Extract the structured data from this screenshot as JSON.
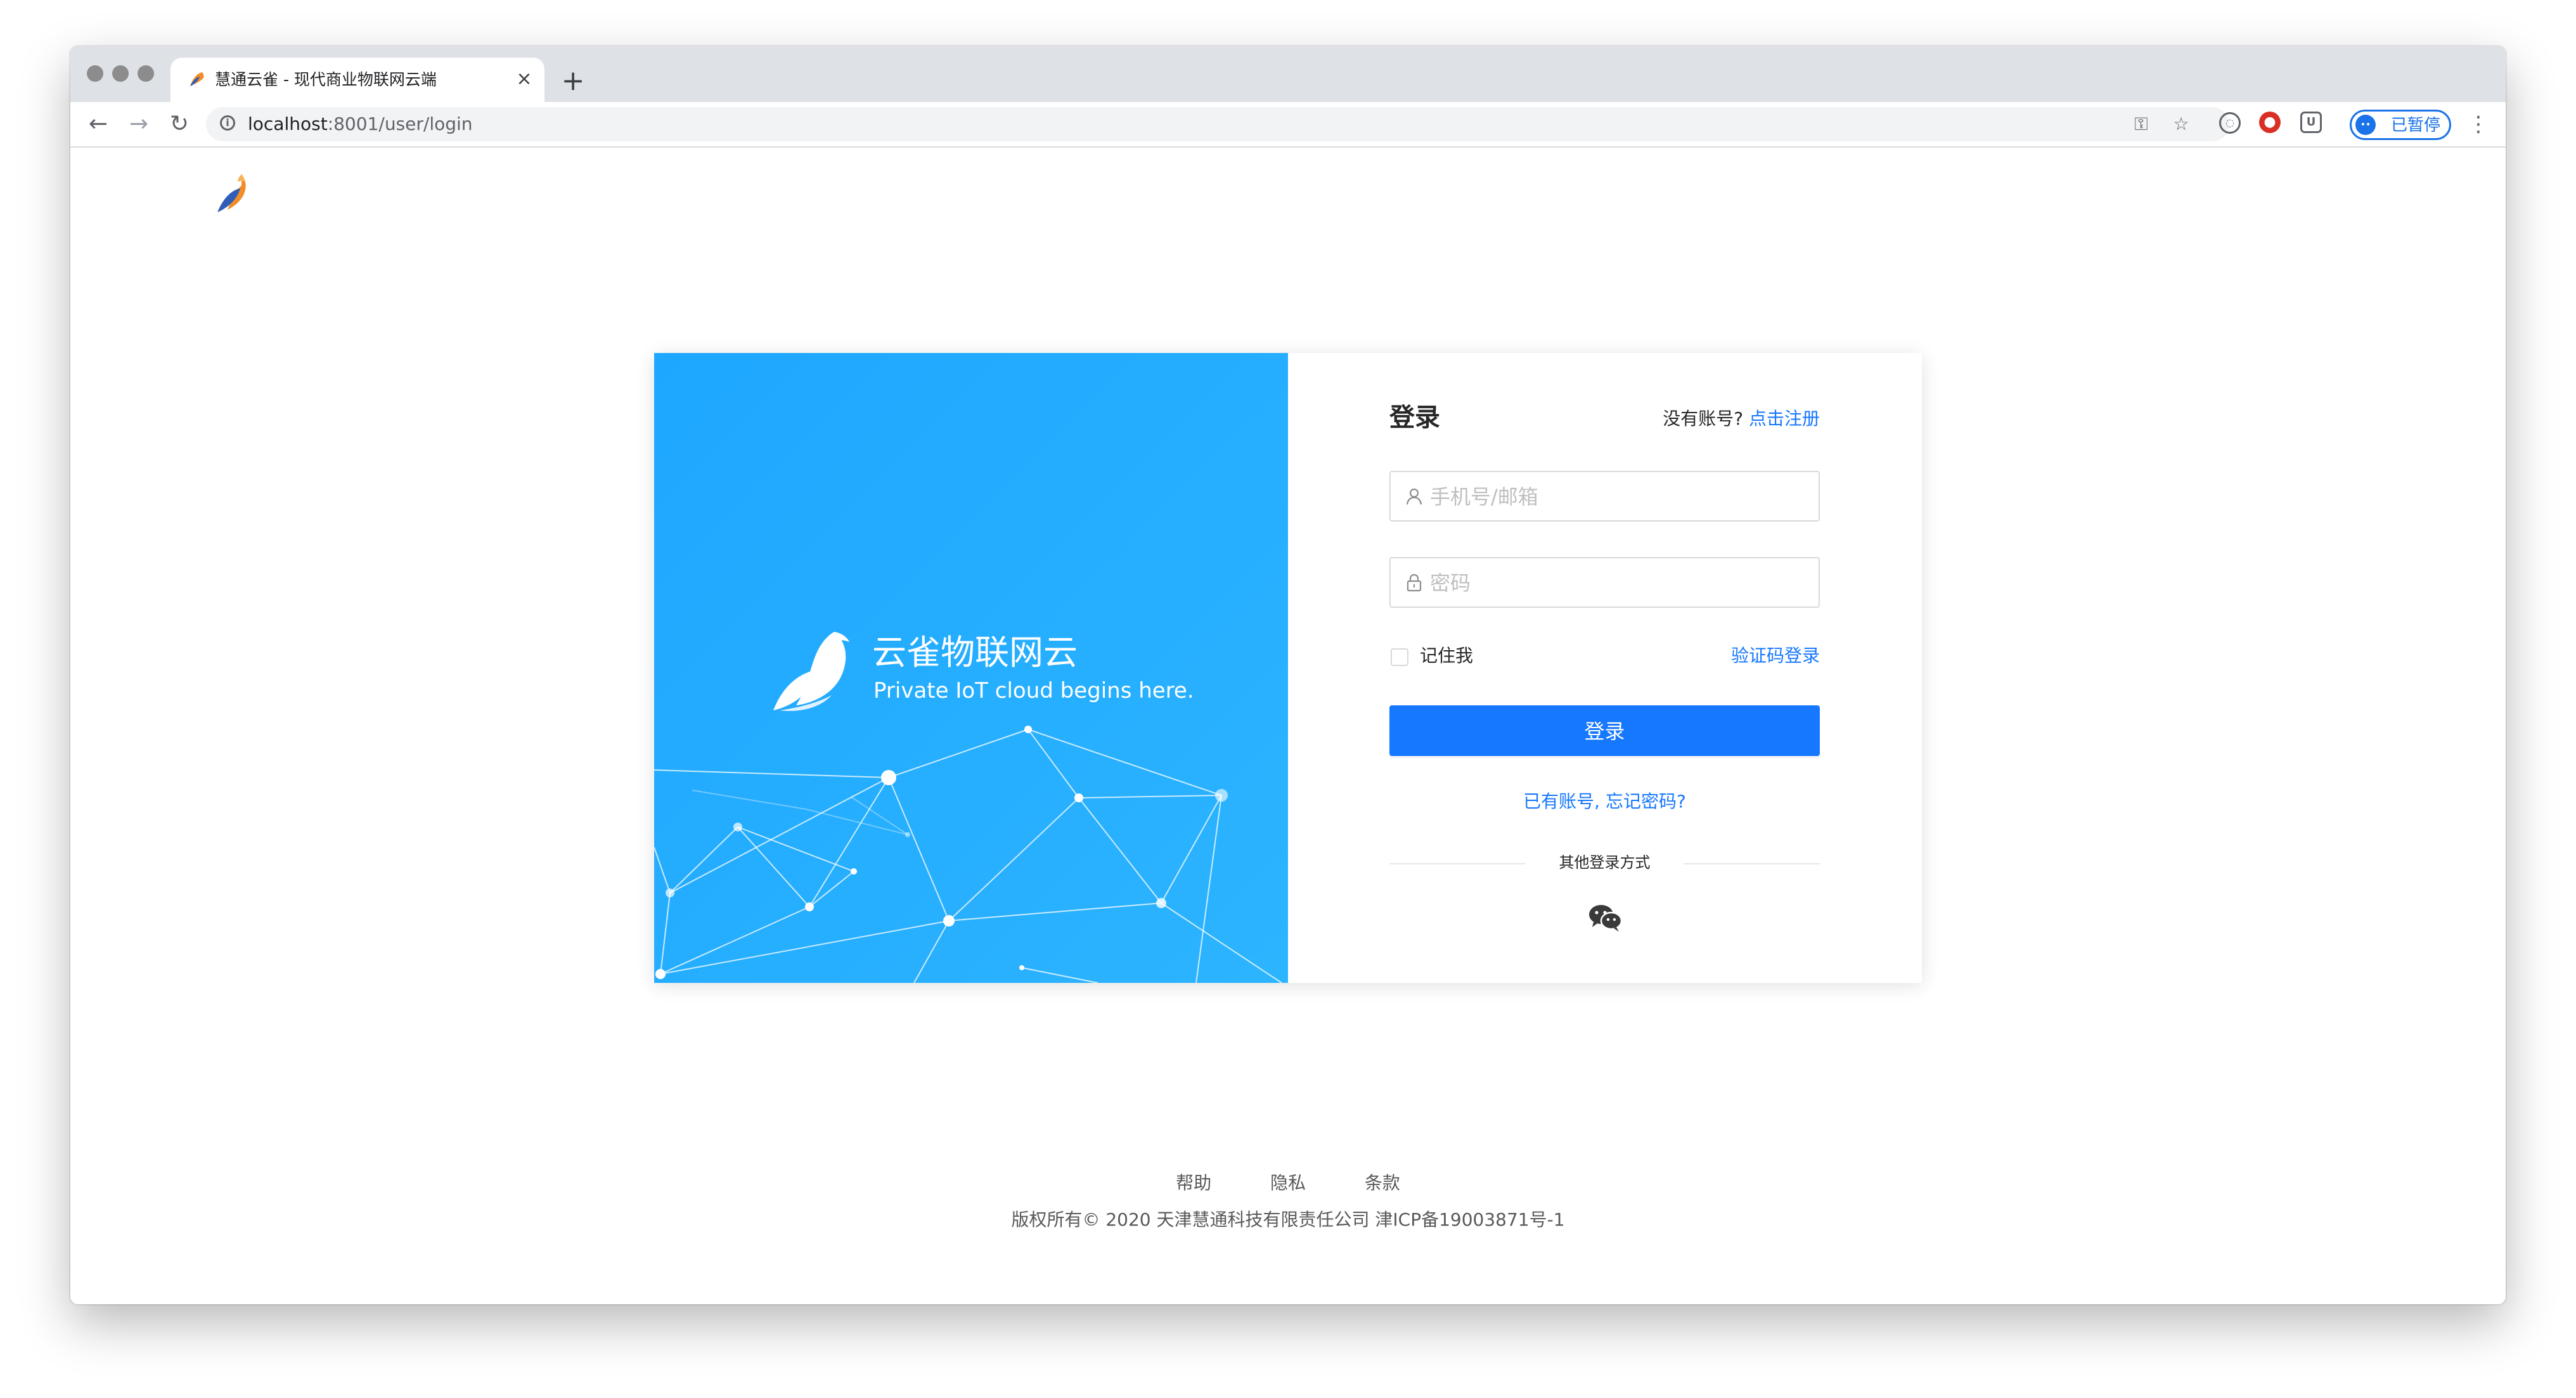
{
  "browser": {
    "tab_title": "慧通云雀 - 现代商业物联网云端",
    "tab_close": "×",
    "new_tab": "+",
    "url_host": "localhost",
    "url_path": ":8001/user/login",
    "profile_label": "已暂停",
    "menu": "⋮"
  },
  "hero": {
    "title": "云雀物联网云",
    "subtitle": "Private IoT cloud begins here."
  },
  "login": {
    "title": "登录",
    "no_account": "没有账号?",
    "register_link": "点击注册",
    "account_placeholder": "手机号/邮箱",
    "password_placeholder": "密码",
    "remember_label": "记住我",
    "sms_login": "验证码登录",
    "login_button": "登录",
    "forgot_link": "已有账号, 忘记密码?",
    "other_methods": "其他登录方式"
  },
  "footer": {
    "links": [
      "帮助",
      "隐私",
      "条款"
    ],
    "copyright": "版权所有© 2020 天津慧通科技有限责任公司 津ICP备19003871号-1"
  },
  "colors": {
    "primary": "#1677ff",
    "hero_bg": "#1ea7ff",
    "text": "#262626",
    "muted": "#595959"
  }
}
